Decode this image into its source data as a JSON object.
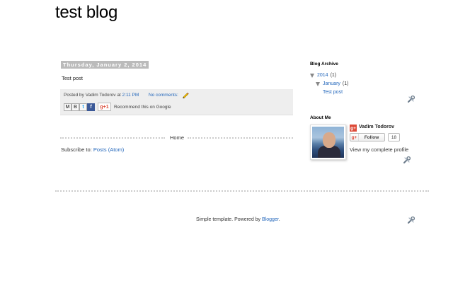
{
  "header": {
    "blog_title": "test blog"
  },
  "post": {
    "date_header": "Thursday, January 2, 2014",
    "body": "Test post",
    "footer": {
      "posted_by": "Posted by",
      "author": "Vadim Todorov",
      "at": "at",
      "time": "2:11 PM",
      "comments": "No comments:",
      "share_buttons": [
        {
          "name": "email",
          "icon": "M"
        },
        {
          "name": "blogthis",
          "icon": "B"
        },
        {
          "name": "twitter",
          "icon": "t"
        },
        {
          "name": "facebook",
          "icon": "f"
        }
      ],
      "gplus_label": "g+1",
      "recommend_text": "Recommend this on Google"
    }
  },
  "nav": {
    "home_label": "Home"
  },
  "subscribe": {
    "label": "Subscribe to:",
    "link": "Posts (Atom)"
  },
  "sidebar": {
    "archive_title": "Blog Archive",
    "archive": [
      {
        "label": "2014",
        "count": "(1)"
      },
      {
        "label": "January",
        "count": "(1)"
      },
      {
        "label": "Test post"
      }
    ],
    "about_title": "About Me",
    "profile": {
      "gplus_icon": "g+",
      "name": "Vadim Todorov",
      "follow_icon": "g+",
      "follow_label": "Follow",
      "follower_count": "18",
      "profile_link": "View my complete profile"
    }
  },
  "footer": {
    "attribution_prefix": "Simple template. Powered by",
    "attribution_link": "Blogger",
    "attribution_suffix": "."
  },
  "colors": {
    "link": "#2266bb",
    "date_header_bg": "#bbbbbb",
    "post_footer_bg": "#eeeeee",
    "gplus_red": "#dd4b39"
  }
}
